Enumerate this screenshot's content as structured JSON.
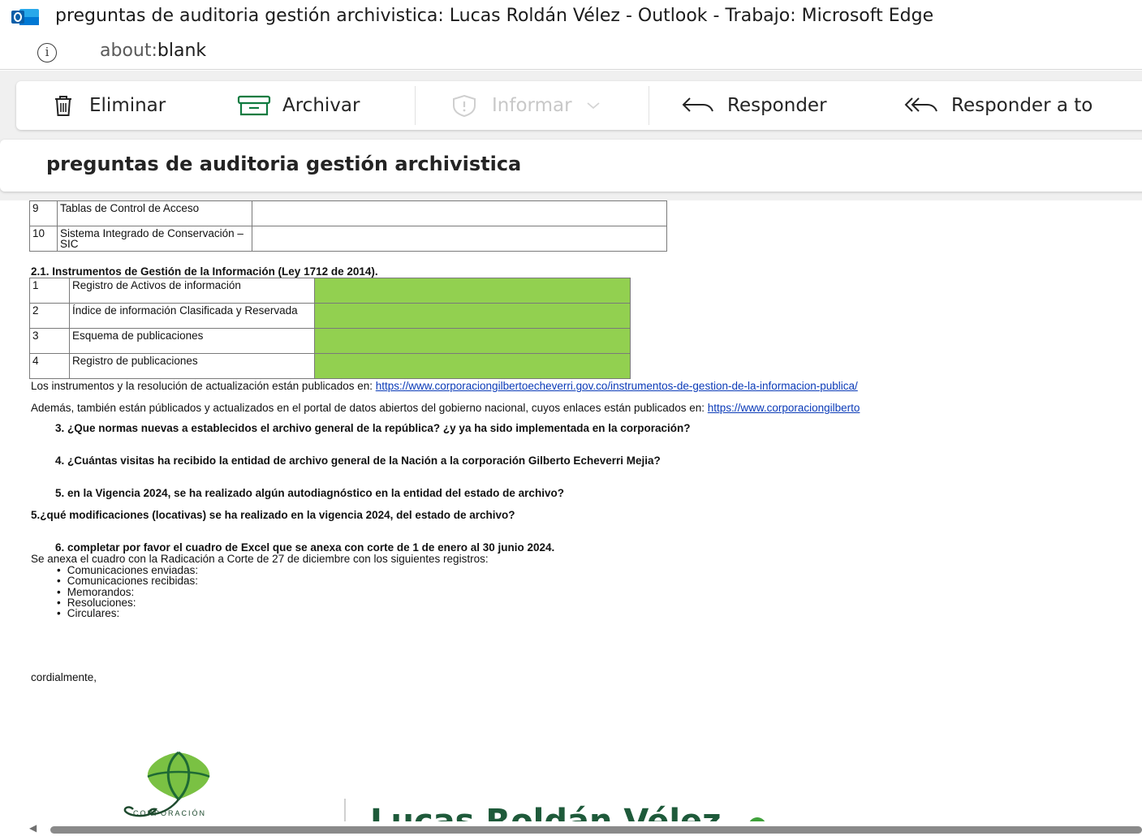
{
  "window": {
    "title": "preguntas de auditoria gestión archivistica: Lucas Roldán Vélez - Outlook - Trabajo: Microsoft Edge",
    "app_icon": "outlook-icon"
  },
  "address_bar": {
    "prefix": "about:",
    "bold": "blank"
  },
  "toolbar": {
    "delete_label": "Eliminar",
    "archive_label": "Archivar",
    "report_label": "Informar",
    "reply_label": "Responder",
    "reply_all_label": "Responder a to"
  },
  "subject": "preguntas de auditoria gestión archivistica",
  "body": {
    "table_top": [
      {
        "num": "9",
        "label": "Tablas de Control de Acceso"
      },
      {
        "num": "10",
        "label": "Sistema Integrado de Conservación – SIC"
      }
    ],
    "section_heading": "2.1. Instrumentos de Gestión de la Información (Ley 1712 de 2014).",
    "instruments": [
      {
        "num": "1",
        "label": "Registro de Activos de información"
      },
      {
        "num": "2",
        "label": "Índice de información Clasificada y Reservada"
      },
      {
        "num": "3",
        "label": "Esquema de publicaciones"
      },
      {
        "num": "4",
        "label": "Registro de publicaciones"
      }
    ],
    "highlight_color": "#92d050",
    "published_text": "Los instrumentos y la resolución de actualización están publicados en: ",
    "published_link": "https://www.corporaciongilbertoecheverri.gov.co/instrumentos-de-gestion-de-la-informacion-publica/",
    "open_data_text": "Además, también están públicados y actualizados en el portal de datos abiertos del gobierno nacional, cuyos enlaces están publicados en: ",
    "open_data_link": "https://www.corporaciongilberto",
    "q3": "3.  ¿Que normas nuevas a establecidos el archivo general de la república? ¿y ya ha sido implementada en la corporación?",
    "q4": "4. ¿Cuántas visitas ha recibido la entidad de archivo general de la Nación a la corporación Gilberto Echeverri Mejia?",
    "q5a": "5. en la Vigencia 2024, se ha realizado algún autodiagnóstico en la entidad del estado de archivo?",
    "q5b": "5.¿qué modificaciones (locativas) se ha realizado en la vigencia 2024, del estado de archivo?",
    "q6": "6. completar por favor el cuadro de Excel que se anexa con corte de 1 de enero al 30 junio 2024.",
    "annex_text": "Se anexa el cuadro con la Radicación a Corte de 27 de diciembre con los siguientes registros:",
    "bullets": [
      "Comunicaciones enviadas:",
      "Comunicaciones recibidas:",
      "Memorandos:",
      "Resoluciones:",
      "Circulares:"
    ],
    "closing": "cordialmente,"
  },
  "signature": {
    "logo_text": "CORPORACIÓN",
    "name": "Lucas Roldán Vélez"
  }
}
